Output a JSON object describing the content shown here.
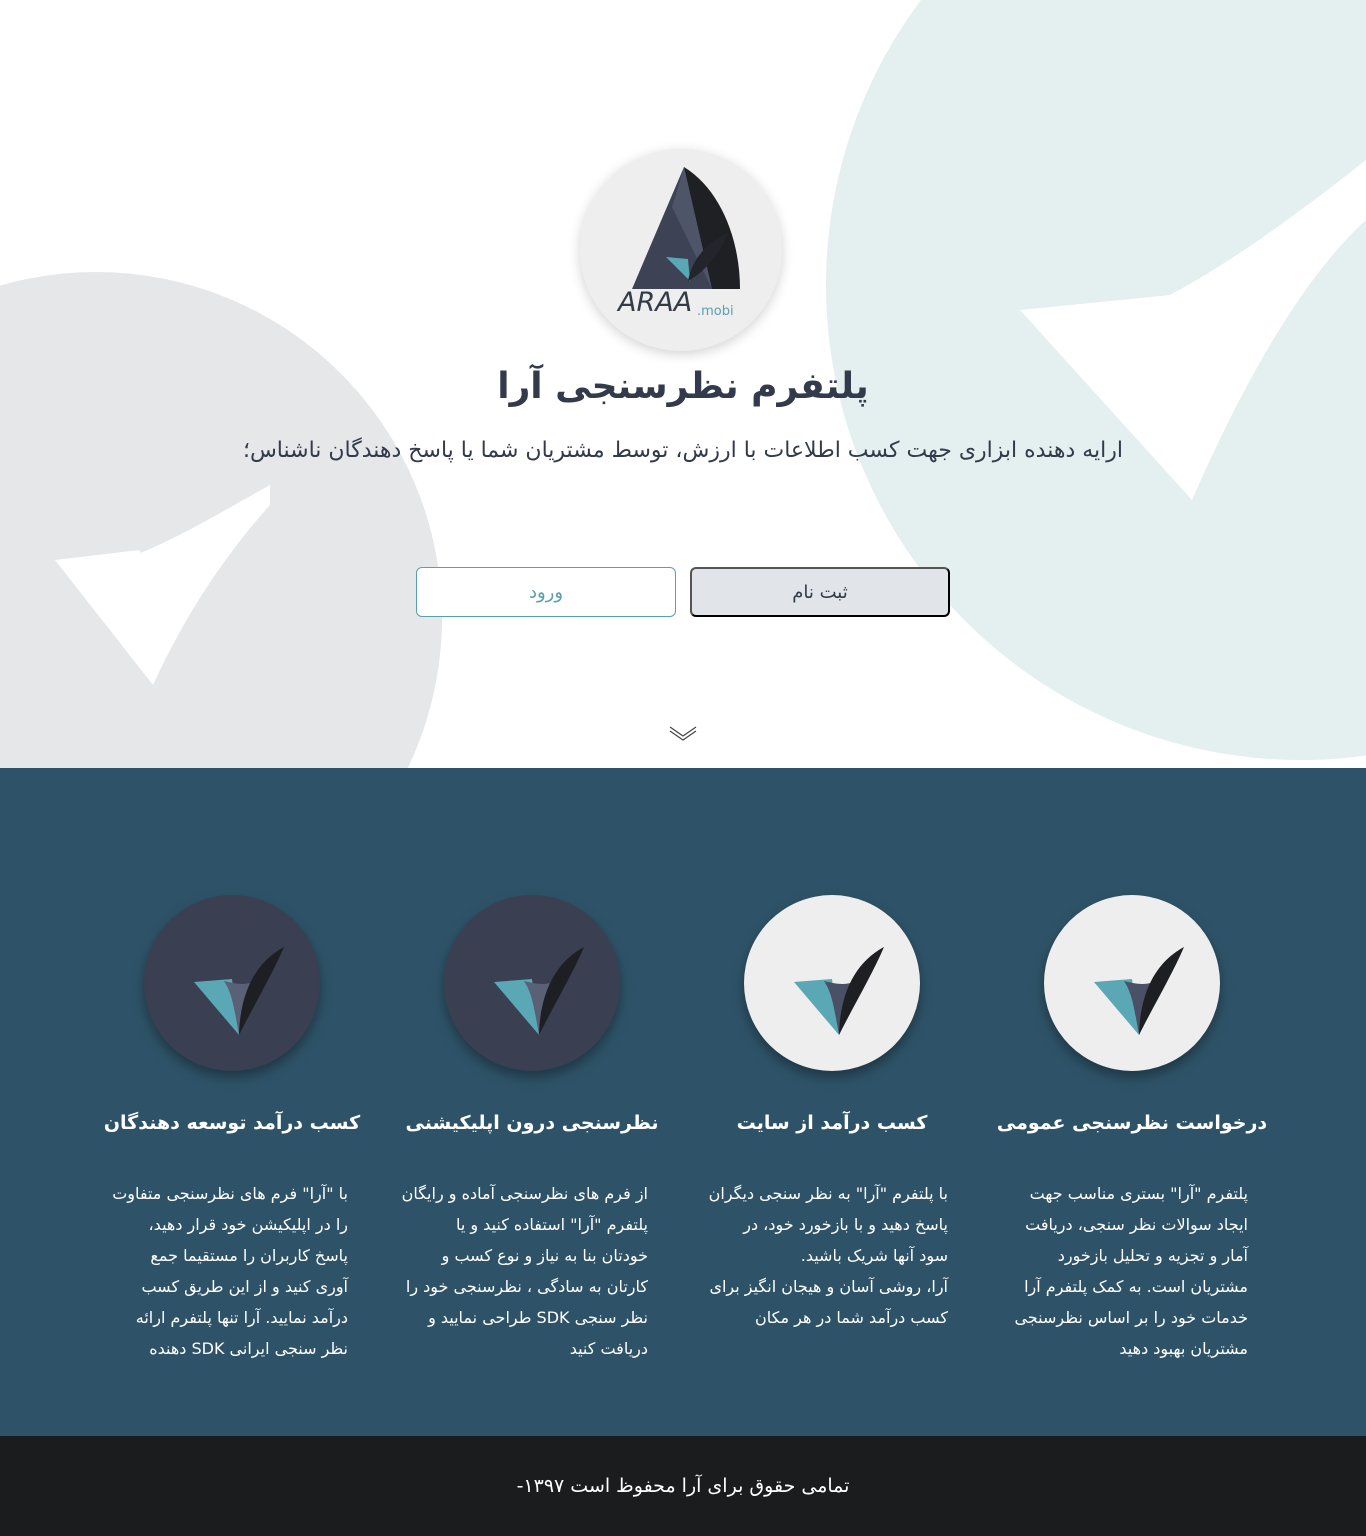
{
  "brand": {
    "logo_text": "ARAA",
    "logo_suffix": ".mobi"
  },
  "hero": {
    "title": "پلتفرم نظرسنجی آرا",
    "subtitle": "ارایه دهنده ابزاری جهت کسب اطلاعات با ارزش، توسط مشتریان شما یا پاسخ دهندگان ناشناس؛",
    "register_label": "ثبت نام",
    "login_label": "ورود"
  },
  "colors": {
    "accent": "#5a9fb0",
    "dark_navy": "#2e5368",
    "footer_bg": "#1b1c1e",
    "text_dark": "#323a4b"
  },
  "features": [
    {
      "title": "درخواست نظرسنجی عمومی",
      "icon": "araa-check-icon",
      "lines": [
        "پلتفرم \"آرا\" بستری مناسب جهت",
        "ایجاد سوالات نظر سنجی، دریافت",
        "آمار و تجزیه و تحلیل بازخورد",
        "مشتریان است. به کمک پلتفرم آرا",
        "خدمات خود را بر اساس نظرسنجی",
        "مشتریان بهبود دهید"
      ]
    },
    {
      "title": "کسب درآمد از سایت",
      "icon": "araa-check-icon",
      "lines": [
        "با پلتفرم \"آرا\" به نظر سنجی دیگران",
        "پاسخ دهید و با بازخورد خود، در",
        "سود آنها شریک باشید.",
        "آرا، روشی آسان و هیجان انگیز برای",
        "کسب درآمد شما در هر مکان"
      ]
    },
    {
      "title": "نظرسنجی درون اپلیکیشنی",
      "icon": "araa-check-icon",
      "lines": [
        "از فرم های نظرسنجی آماده و رایگان",
        "پلتفرم \"آرا\" استفاده کنید و یا",
        "خودتان بنا به نیاز و نوع کسب و",
        "کارتان به سادگی ، نظرسنجی خود را",
        "نظر سنجی SDK طراحی نمایید و",
        "دریافت کنید"
      ]
    },
    {
      "title": "کسب درآمد توسعه دهندگان",
      "icon": "araa-check-icon",
      "lines": [
        "با \"آرا\" فرم های نظرسنجی متفاوت",
        "را در اپلیکیشن خود قرار دهید،",
        "پاسخ کاربران را مستقیما جمع",
        "آوری کنید و از این طریق کسب",
        "درآمد نمایید. آرا تنها پلتفرم ارائه",
        "نظر سنجی ایرانی SDK دهنده"
      ]
    }
  ],
  "footer": {
    "copyright": "تمامی حقوق برای آرا محفوظ است ۱۳۹۷-"
  }
}
